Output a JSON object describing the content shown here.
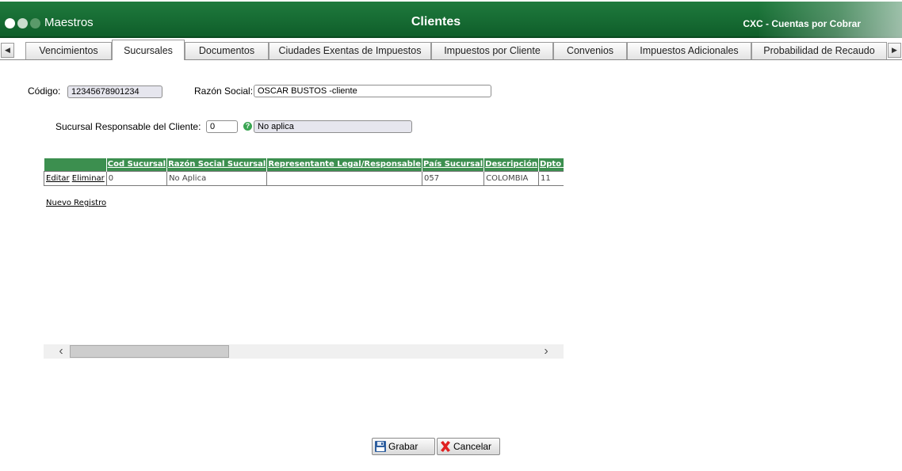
{
  "header": {
    "app_title": "Maestros",
    "page_title": "Clientes",
    "module": "CXC - Cuentas por Cobrar",
    "dot_colors": [
      "#ffffff",
      "#c9dccd",
      "#5a9a6a"
    ]
  },
  "tabs": [
    {
      "label": "Vencimientos"
    },
    {
      "label": "Sucursales"
    },
    {
      "label": "Documentos"
    },
    {
      "label": "Ciudades Exentas de Impuestos"
    },
    {
      "label": "Impuestos por Cliente"
    },
    {
      "label": "Convenios"
    },
    {
      "label": "Impuestos Adicionales"
    },
    {
      "label": "Probabilidad de Recaudo"
    }
  ],
  "active_tab": "Sucursales",
  "form": {
    "codigo_label": "Código:",
    "codigo_value": "12345678901234",
    "razon_label": "Razón Social:",
    "razon_value": "OSCAR BUSTOS -cliente",
    "sucursal_label": "Sucursal Responsable del Cliente:",
    "sucursal_code": "0",
    "sucursal_desc": "No aplica"
  },
  "grid": {
    "columns": [
      "Cod Sucursal",
      "Razón Social Sucursal",
      "Representante Legal/Responsable",
      "País Sucursal",
      "Descripción",
      "Dpto Sucursal"
    ],
    "rows": [
      {
        "edit": "Editar",
        "delete": "Eliminar",
        "cells": [
          "0",
          "No Aplica",
          "",
          "057",
          "COLOMBIA",
          "11"
        ]
      }
    ],
    "new_record": "Nuevo Registro"
  },
  "buttons": {
    "save": "Grabar",
    "cancel": "Cancelar"
  },
  "colors": {
    "header_green": "#1f7a3d",
    "grid_header_green": "#3c8f4f",
    "cancel_red": "#e02020",
    "save_blue": "#2e5e9e"
  }
}
